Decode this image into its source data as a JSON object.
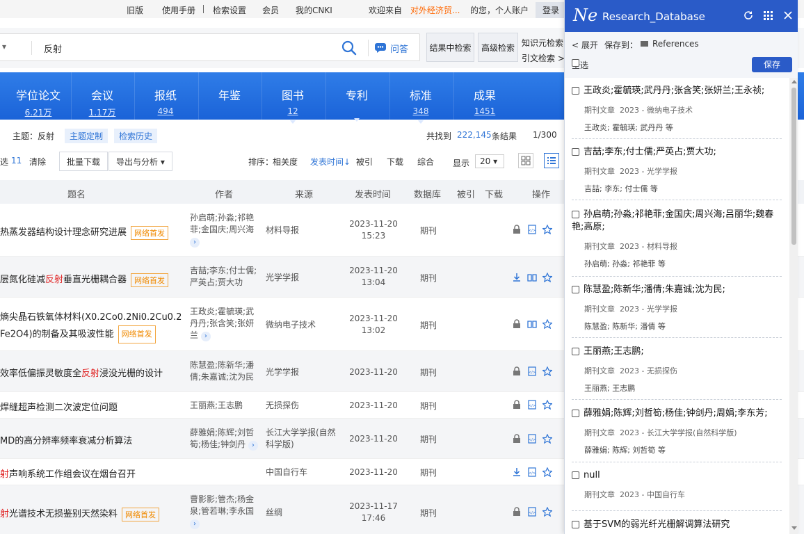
{
  "topbar": {
    "old": "旧版",
    "manual": "使用手册",
    "settings": "检索设置",
    "member": "会员",
    "mycnki": "我的CNKI",
    "welcome": "欢迎来自",
    "org": "对外经济贸...",
    "suffix": "的您，个人账户",
    "login": "登录"
  },
  "search": {
    "field_arrow": "▾",
    "query": "反射",
    "ask": "问答",
    "in_result": "结果中检索",
    "advanced": "高级检索",
    "knowledge": "知识元检索",
    "citation": "引文检索 >"
  },
  "categories": [
    {
      "name": "学位论文",
      "count": "6.21万"
    },
    {
      "name": "会议",
      "count": "1.17万"
    },
    {
      "name": "报纸",
      "count": "494"
    },
    {
      "name": "年鉴",
      "count": ""
    },
    {
      "name": "图书",
      "count": "12"
    },
    {
      "name": "专利",
      "count": ""
    },
    {
      "name": "标准",
      "count": "348"
    },
    {
      "name": "成果",
      "count": "1451"
    }
  ],
  "subject": {
    "label": "主题：反射",
    "custom": "主题定制",
    "history": "检索历史",
    "found_prefix": "共找到",
    "found_count": "222,145",
    "found_suffix": "条结果",
    "page": "1/300"
  },
  "toolbar": {
    "selected": "选",
    "selected_count": "11",
    "clear": "清除",
    "batch": "批量下载",
    "export": "导出与分析 ▾",
    "sort_label": "排序：",
    "relevance": "相关度",
    "pubtime": "发表时间↓",
    "cited": "被引",
    "download": "下载",
    "combined": "综合",
    "show": "显示",
    "page_size": "20 ▾"
  },
  "table": {
    "headers": {
      "title": "题名",
      "author": "作者",
      "source": "来源",
      "date": "发表时间",
      "db": "数据库",
      "cited": "被引",
      "download": "下载",
      "ops": "操作"
    },
    "rows": [
      {
        "pre": "热蒸发器结构设计理念研究进展",
        "hl": "",
        "post": "",
        "badge": "网络首发",
        "author": "孙启萌;孙淼;祁艳菲;金国庆;周兴海",
        "more": "›",
        "source": "材料导报",
        "date1": "2023-11-20",
        "date2": "15:23",
        "db": "期刊"
      },
      {
        "pre": "层氮化硅减",
        "hl": "反射",
        "post": "垂直光栅耦合器",
        "badge": "网络首发",
        "author": "吉喆;李东;付士儒;严英占;贾大功",
        "more": "",
        "source": "光学学报",
        "date1": "2023-11-20",
        "date2": "13:04",
        "db": "期刊"
      },
      {
        "pre": "熵尖晶石铁氧体材料(X0.2Co0.2Ni0.2Cu0.2",
        "hl": "",
        "post": "Fe2O4)的制备及其吸波性能",
        "badge": "网络首发",
        "author": "王政炎;霍毓瑛;武丹丹;张含笑;张妍兰",
        "more": "›",
        "source": "微纳电子技术",
        "date1": "2023-11-20",
        "date2": "13:02",
        "db": "期刊"
      },
      {
        "pre": "效率低偏振灵敏度全",
        "hl": "反射",
        "post": "浸没光栅的设计",
        "badge": "",
        "author": "陈慧盈;陈新华;潘倩;朱嘉诚;沈为民",
        "more": "",
        "source": "光学学报",
        "date1": "2023-11-20",
        "date2": "",
        "db": "期刊"
      },
      {
        "pre": "焊缝超声检测二次波定位问题",
        "hl": "",
        "post": "",
        "badge": "",
        "author": "王丽燕;王志鹏",
        "more": "",
        "source": "无损探伤",
        "date1": "2023-11-20",
        "date2": "",
        "db": "期刊"
      },
      {
        "pre": "MD的高分辨率频率衰减分析算法",
        "hl": "",
        "post": "",
        "badge": "",
        "author": "薛雅娟;陈辉;刘哲筍;杨佳;钟剑丹",
        "more": "›",
        "source": "长江大学学报(自然科学版)",
        "date1": "2023-11-20",
        "date2": "",
        "db": "期刊"
      },
      {
        "pre": "",
        "hl": "射",
        "post": "声响系统工作组会议在烟台召开",
        "badge": "",
        "author": "",
        "more": "",
        "source": "中国自行车",
        "date1": "2023-11-20",
        "date2": "",
        "db": "期刊"
      },
      {
        "pre": "",
        "hl": "射",
        "post": "光谱技术无损鉴别天然染料",
        "badge": "网络首发",
        "author": "曹影影;管杰;杨金泉;管若琳;李永国",
        "more": "›",
        "source": "丝绸",
        "date1": "2023-11-17",
        "date2": "17:46",
        "db": "期刊"
      }
    ]
  },
  "panel": {
    "logo": "Ne",
    "title": "Research_Database",
    "expand": "< 展开",
    "save_to": "保存到：",
    "folder": "References",
    "select_all": "全选",
    "save": "保存",
    "items": [
      {
        "authors": "王政炎;霍毓瑛;武丹丹;张含笑;张妍兰;王永祯;",
        "type": "期刊文章",
        "year": "2023",
        "journal": "微纳电子技术",
        "short": "王政炎; 霍毓瑛; 武丹丹 等"
      },
      {
        "authors": "吉喆;李东;付士儒;严英占;贾大功;",
        "type": "期刊文章",
        "year": "2023",
        "journal": "光学学报",
        "short": "吉喆; 李东; 付士儒 等"
      },
      {
        "authors": "孙启萌;孙淼;祁艳菲;金国庆;周兴海;吕丽华;魏春艳;高原;",
        "type": "期刊文章",
        "year": "2023",
        "journal": "材料导报",
        "short": "孙启萌; 孙淼; 祁艳菲 等"
      },
      {
        "authors": "陈慧盈;陈新华;潘倩;朱嘉诚;沈为民;",
        "type": "期刊文章",
        "year": "2023",
        "journal": "光学学报",
        "short": "陈慧盈; 陈新华; 潘倩 等"
      },
      {
        "authors": "王丽燕;王志鹏;",
        "type": "期刊文章",
        "year": "2023",
        "journal": "无损探伤",
        "short": "王丽燕; 王志鹏"
      },
      {
        "authors": "薛雅娟;陈辉;刘哲筍;杨佳;钟剑丹;周娟;李东芳;",
        "type": "期刊文章",
        "year": "2023",
        "journal": "长江大学学报(自然科学版)",
        "short": "薛雅娟; 陈辉; 刘哲筍 等"
      },
      {
        "authors": "null",
        "type": "期刊文章",
        "year": "2023",
        "journal": "中国自行车",
        "short": ""
      },
      {
        "authors": "基于SVM的弱光纤光栅解调算法研究",
        "type": "",
        "year": "",
        "journal": "",
        "short": ""
      }
    ]
  }
}
